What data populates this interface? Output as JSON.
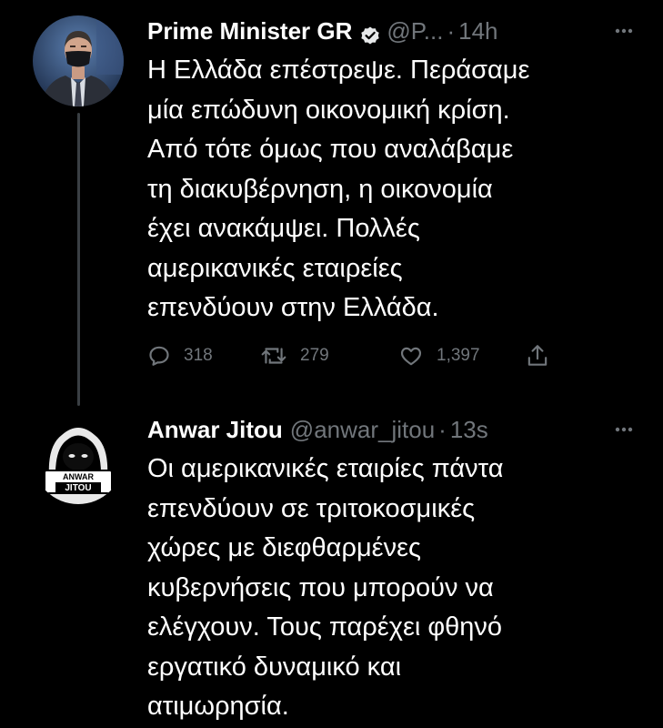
{
  "tweets": [
    {
      "display_name": "Prime Minister GR",
      "handle": "@P...",
      "separator": "·",
      "time": "14h",
      "verified": true,
      "avatar": "profile-photo-man-in-suit-and-mask",
      "text_lines": [
        "Η Ελλάδα επέστρεψε. Περάσαμε",
        "μία επώδυνη οικονομική κρίση.",
        "Από τότε όμως που αναλάβαμε",
        "τη διακυβέρνηση, η οικονομία",
        "έχει ανακάμψει. Πολλές",
        "αμερικανικές εταιρείες",
        "επενδύουν στην Ελλάδα."
      ],
      "actions": {
        "reply_count": "318",
        "retweet_count": "279",
        "like_count": "1,397"
      }
    },
    {
      "display_name": "Anwar Jitou",
      "handle": "@anwar_jitou",
      "separator": "·",
      "time": "13s",
      "verified": false,
      "avatar": "hooded-figure-logo",
      "avatar_text": [
        "ANWAR",
        "JITOU"
      ],
      "text_lines": [
        "Οι αμερικανικές εταιρίες πάντα",
        "επενδύουν σε τριτοκοσμικές",
        "χώρες με διεφθαρμένες",
        "κυβερνήσεις που μπορούν να",
        "ελέγχουν. Τους παρέχει φθηνό",
        "εργατικό δυναμικό και",
        "ατιμωρησία."
      ]
    }
  ],
  "colors": {
    "background": "#000000",
    "primary_text": "#ffffff",
    "secondary_text": "#71767b",
    "thread_line": "#3a3f44"
  },
  "icons": {
    "more": "more-horizontal-icon",
    "verified": "verified-badge-icon",
    "reply": "reply-icon",
    "retweet": "retweet-icon",
    "like": "like-icon",
    "share": "share-icon"
  }
}
